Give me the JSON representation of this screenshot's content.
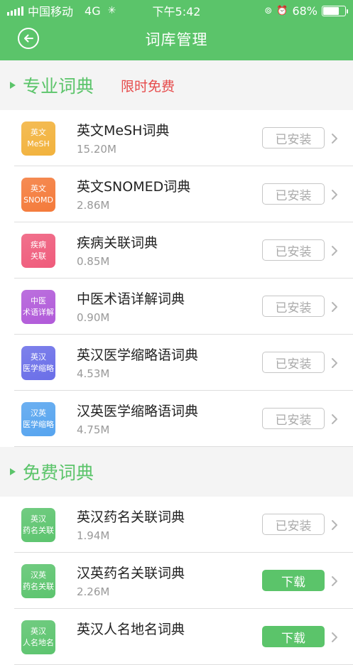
{
  "status_bar": {
    "carrier": "中国移动",
    "network": "4G",
    "time": "下午5:42",
    "battery": "68%",
    "battery_level": 0.68
  },
  "header": {
    "title": "词库管理"
  },
  "sections": [
    {
      "title": "专业词典",
      "promo": "限时免费"
    },
    {
      "title": "免费词典"
    }
  ],
  "pro_items": [
    {
      "badge_top": "英文",
      "badge_bottom": "MeSH",
      "color": "#f2b23c",
      "name": "英文MeSH词典",
      "size": "15.20M",
      "action": "已安装"
    },
    {
      "badge_top": "英文",
      "badge_bottom": "SNOMD",
      "color": "#f47a3a",
      "name": "英文SNOMED词典",
      "size": "2.86M",
      "action": "已安装"
    },
    {
      "badge_top": "疾病",
      "badge_bottom": "关联",
      "color": "#ef5b7b",
      "name": "疾病关联词典",
      "size": "0.85M",
      "action": "已安装"
    },
    {
      "badge_top": "中医",
      "badge_bottom": "术语详解",
      "color": "#b15ad9",
      "name": "中医术语详解词典",
      "size": "0.90M",
      "action": "已安装"
    },
    {
      "badge_top": "英汉",
      "badge_bottom": "医学缩略",
      "color": "#6a6ee8",
      "name": "英汉医学缩略语词典",
      "size": "4.53M",
      "action": "已安装"
    },
    {
      "badge_top": "汉英",
      "badge_bottom": "医学缩略",
      "color": "#56a4ef",
      "name": "汉英医学缩略语词典",
      "size": "4.75M",
      "action": "已安装"
    }
  ],
  "free_items": [
    {
      "badge_top": "英汉",
      "badge_bottom": "药名关联",
      "color": "#5cc46e",
      "name": "英汉药名关联词典",
      "size": "1.94M",
      "action": "已安装"
    },
    {
      "badge_top": "汉英",
      "badge_bottom": "药名关联",
      "color": "#5cc46e",
      "name": "汉英药名关联词典",
      "size": "2.26M",
      "action": "下载"
    },
    {
      "badge_top": "英汉",
      "badge_bottom": "人名地名",
      "color": "#5cc46e",
      "name": "英汉人名地名词典",
      "size": "",
      "action": "下载"
    }
  ]
}
